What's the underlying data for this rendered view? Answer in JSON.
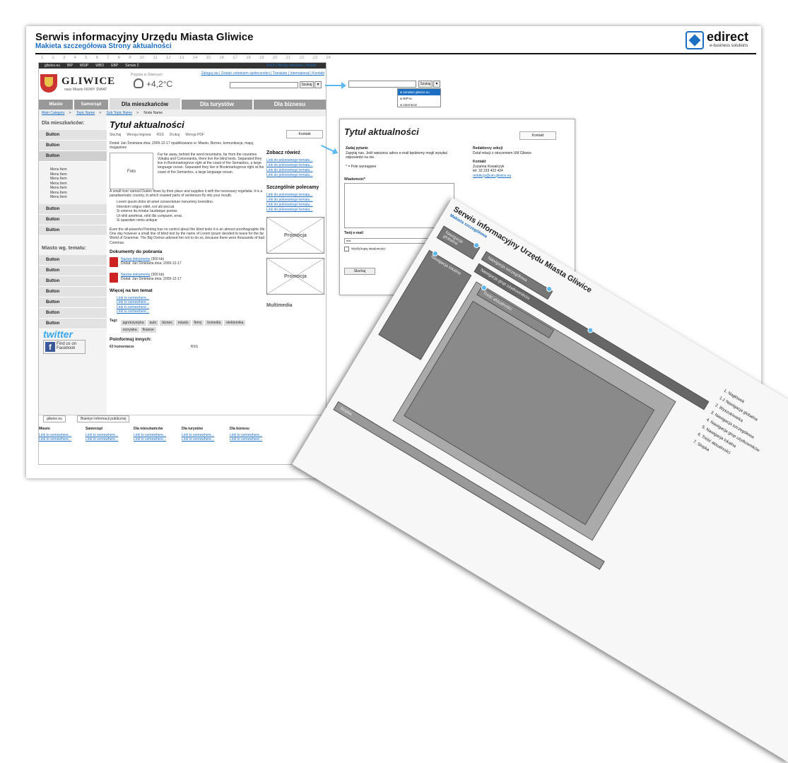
{
  "doc": {
    "title": "Serwis informacyjny Urzędu Miasta Gliwice",
    "subtitle": "Makieta szczegółowa Strony aktualności",
    "logo_name": "edirect",
    "logo_tagline": "e-business solutions",
    "grid_numbers": [
      "1",
      "2",
      "3",
      "4",
      "5",
      "6",
      "7",
      "8",
      "9",
      "10",
      "11",
      "12",
      "13",
      "14",
      "15",
      "16",
      "17",
      "18",
      "19",
      "20",
      "21",
      "22",
      "23",
      "24"
    ]
  },
  "site": {
    "topbar": [
      "gliwice.eu",
      "BIP",
      "MSIP",
      "WBO",
      "EBP",
      "Serwis 2"
    ],
    "topbar_right": "A A A  |  Wersja tekstowa  |  Mobile",
    "logo": "GLIWICE",
    "logo_motto": "nasz Miasto NOWY ŚWIAT",
    "weather_label": "Pogoda w Gliwicach",
    "weather_temp": "+4,2°C",
    "toplinks": "Zaloguj się | Zostań członkiem społeczności | Translate | International | Kontakt",
    "search_button": "Szukaj",
    "search_dropdown": "▾",
    "tabs_small": [
      "Miasto",
      "Samorząd"
    ],
    "tabs": [
      "Dla mieszkańców",
      "Dla turystów",
      "Dla biznesu"
    ],
    "breadcrumbs": [
      "Main Category",
      "Topic Name",
      "Sub Topic Name",
      "Node Name"
    ],
    "breadcrumb_sep": ">",
    "sidebar": {
      "heading1": "Dla mieszkańców:",
      "buttons1": [
        "Button",
        "Button",
        "Button"
      ],
      "menu_items": [
        "Menu Item",
        "Menu Item",
        "Menu Item",
        "Menu Item",
        "Menu Item",
        "Menu Item",
        "Menu Item"
      ],
      "buttons2": [
        "Button",
        "Button",
        "Button"
      ],
      "heading2": "Miasto wg. tematu:",
      "buttons3": [
        "Button",
        "Button",
        "Button",
        "Button",
        "Button",
        "Button",
        "Button"
      ],
      "twitter": "twitter",
      "facebook": "Find us on Facebook"
    },
    "article": {
      "title": "Tytuł aktualności",
      "tools": [
        "Słuchaj",
        "Wersja migowa",
        "RSS",
        "Drukuj",
        "Wersja PDF"
      ],
      "meta": "Dodał: Jan Śmietana dnia: 2009-12-17 opublikowano w: Miasto, Biznes, komunikacja, mapy, magazines",
      "foto": "Foto",
      "para1": "Far far away, behind the word mountains, far from the countries Vokalia and Consonantia, there live the blind texts. Separated they live in Bookmarksgrove right at the coast of the Semantics, a large language ocean. Separated they live in Bookmarksgrove right at the coast of the Semantics, a large language ocean.",
      "para2": "A small river named Duden flows by their place and supplies it with the necessary regelialia. It is a paradisematic country, in which roasted parts of sentences fly into your mouth.",
      "list": [
        "Lorem ipsum dolor sit amet consectetuer nonummy lorendino.",
        "Interdum volgus videt, est ubi peccat.",
        "Si veteres ita miratur laudatque poetas",
        "Ut nihil anteferat, nihil illis comparet, errat.",
        "Si quaedam nimis antique"
      ],
      "para3": "Even the all-powerful Pointing has no control about the blind texts it is an almost unorthographic life One day however a small line of blind text by the name of Lorem Ipsum decided to leave for the far World of Grammar. The Big Oxmox advised her not to do so, because there were thousands of bad Commas.",
      "docs_heading": "Dokumenty do pobrania",
      "docs": [
        {
          "name": "Nazwa dokumentu",
          "size": "(300 kb)",
          "meta": "Dodał: Jan Śmietana dnia: 2009-12-17"
        },
        {
          "name": "Nazwa dokumentu",
          "size": "(300 kb)",
          "meta": "Dodał: Jan Śmietana dnia: 2009-12-17"
        }
      ],
      "more_heading": "Więcej na ten temat",
      "more_links": [
        "Link to somewhere...",
        "Link to somewhere...",
        "Link to somewhere...",
        "Link to somewhere..."
      ],
      "tags_label": "Tagi:",
      "tags": [
        "agroturystyka",
        "auto",
        "biznes",
        "miasto",
        "firmy",
        "komedia",
        "elektronika",
        "rozrywka",
        "finanse"
      ],
      "share_label": "Poinformuj innych:",
      "comments": "63 komentarze",
      "rss": "RSS",
      "kontakt": "Kontakt"
    },
    "right": {
      "see_also": "Zobacz rówież",
      "see_links": [
        "Link do pokrewnego tematu...",
        "Link do pokrewnego tematu...",
        "Link do pokrewnego tematu...",
        "Link do pokrewnego tematu..."
      ],
      "recommended": "Szczególnie polecamy",
      "rec_links": [
        "Link do pokrewnego tematu...",
        "Link do pokrewnego tematu...",
        "Link do pokrewnego tematu...",
        "Link do pokrewnego tematu..."
      ],
      "promo": "Promocja",
      "multimedia": "Multimedia"
    },
    "footer": {
      "tabs": [
        "gliwice.eu",
        "Biuletyn Informacji publicznej"
      ],
      "cols": [
        "Miasto",
        "Samorząd",
        "Dla mieszkańców",
        "Dla turystów",
        "Dla biznesu"
      ],
      "link": "Link to somewhere..."
    }
  },
  "zoom_search": {
    "button": "Szukaj",
    "dropdown": "▾",
    "options": [
      "w serwisie gliwice.eu",
      "w BIP-ie",
      "w internecie"
    ]
  },
  "kontakt_panel": {
    "title": "Tytuł aktualności",
    "kontakt": "Kontakt",
    "ask_heading": "Zadaj pytanie",
    "ask_text": "Zapytaj nas. Jeśli wpiszesz adres e-mail będziemy mogli wysyłać odpowiedzi na nie.",
    "required": "* = Pole wymagane",
    "message_label": "Wiadomość*",
    "email_label": "Twój e-mail",
    "email_value": "test",
    "copy_label": "Wyślij kopię wiadomości",
    "send": "Słuchaj",
    "editors_heading": "Redaktorzy sekcji",
    "editors_text": "Dział relacji z otoczeniem UM Gliwice",
    "contact_heading": "Kontakt",
    "contact_name": "Zuzanna Kowalczyk",
    "contact_tel": "tel: 32 233 423 424",
    "contact_email": "redakcja@um.gliwice.eu"
  },
  "tilted": {
    "title": "Serwis informacyjny Urzędu Miasta Gliwice",
    "subtitle": "Makieta szczegółowa",
    "bars": [
      "Nawigacja globalna",
      "Nawigacja szczegółowa",
      "Nawigacja grup użytkowników",
      "Nawigacja lokalna",
      "Treść aktualności",
      "Stopka"
    ],
    "toc": [
      "1. Nagłówek",
      "1.1 Nawigacja globalna",
      "2. Wyszukiwarka",
      "3. Nawigacja szczegółowa",
      "4. Nawigacja grup użytkowników",
      "5. Nawigacja lokalna",
      "6. Treść aktualności",
      "7. Stopka"
    ]
  }
}
